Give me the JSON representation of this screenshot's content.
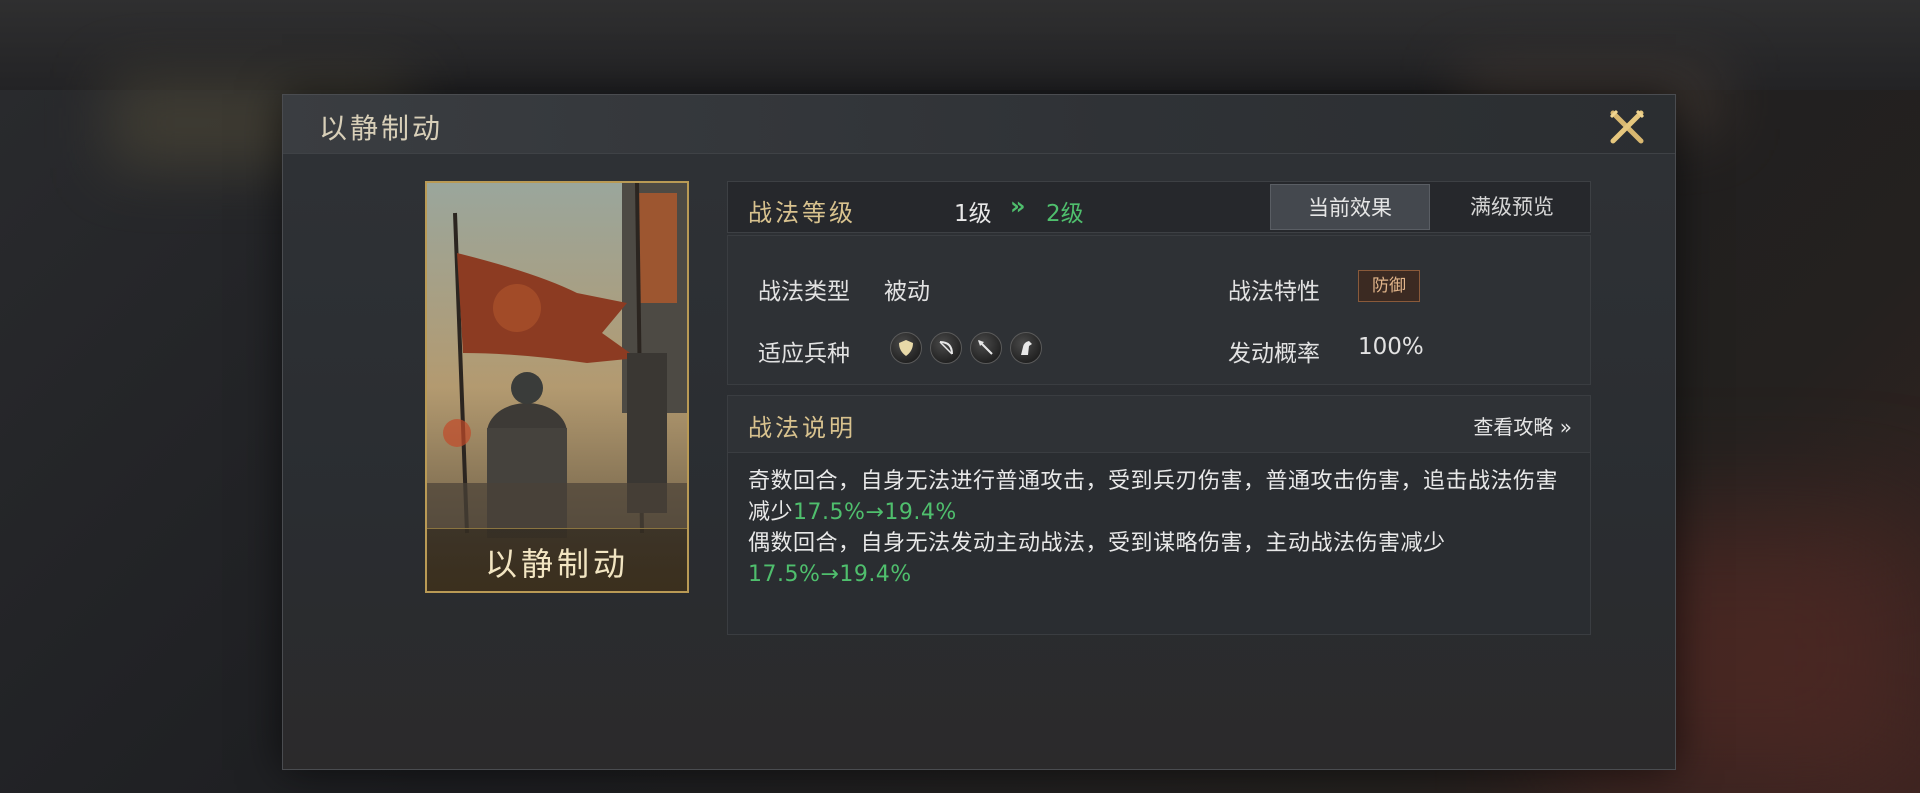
{
  "dialog": {
    "title": "以静制动",
    "close_icon": "close-crossed-swords-icon"
  },
  "card": {
    "name": "以静制动",
    "art_icon": "battle-banner-artwork"
  },
  "level": {
    "label": "战法等级",
    "current": "1级",
    "arrow": "»",
    "next": "2级",
    "tabs": [
      {
        "label": "当前效果",
        "active": true
      },
      {
        "label": "满级预览",
        "active": false
      }
    ]
  },
  "info": {
    "type_key": "战法类型",
    "type_value": "被动",
    "trait_key": "战法特性",
    "trait_value": "防御",
    "troop_key": "适应兵种",
    "troop_icons": [
      "shield-icon",
      "bow-icon",
      "spear-icon",
      "horse-icon"
    ],
    "rate_key": "发动概率",
    "rate_value": "100%"
  },
  "description": {
    "title": "战法说明",
    "guide_link": "查看攻略 »",
    "line1_text": "奇数回合，自身无法进行普通攻击，受到兵刃伤害，普通攻击伤害，追击战法伤害减少",
    "line1_value": "17.5%→19.4%",
    "line2_text": "偶数回合，自身无法发动主动战法，受到谋略伤害，主动战法伤害减少",
    "line2_value": "17.5%→19.4%"
  },
  "colors": {
    "gold": "#d8c28e",
    "green": "#4fbf6d",
    "card_border": "#b99a55"
  }
}
